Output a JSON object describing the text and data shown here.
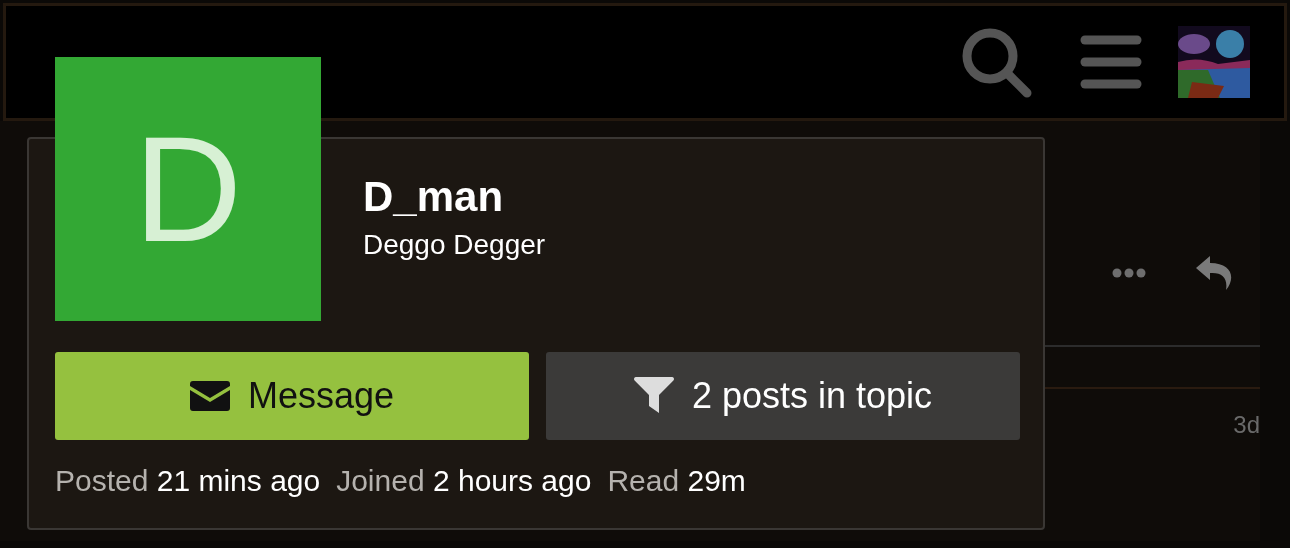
{
  "topic": {
    "timestamp": "3d"
  },
  "user_card": {
    "initial": "D",
    "username": "D_man",
    "full_name": "Deggo Degger",
    "buttons": [
      {
        "kind": "message",
        "label": "Message"
      },
      {
        "kind": "filter",
        "label": "2 posts in topic"
      }
    ],
    "stats": [
      {
        "label": "Posted",
        "value": "21 mins ago"
      },
      {
        "label": "Joined",
        "value": "2 hours ago"
      },
      {
        "label": "Read",
        "value": "29m"
      }
    ]
  }
}
